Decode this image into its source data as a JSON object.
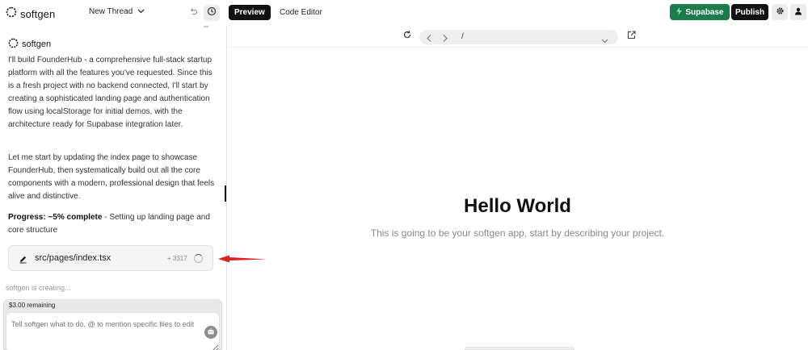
{
  "header": {
    "brand": "softgen",
    "thread_label": "New Thread",
    "tabs": [
      {
        "label": "Preview",
        "active": true
      },
      {
        "label": "Code Editor",
        "active": false
      }
    ],
    "supabase_label": "Supabase",
    "publish_label": "Publish",
    "colors": {
      "supabase": "#1c7a4d",
      "publish": "#111111"
    }
  },
  "chat": {
    "sender": "softgen",
    "paragraphs": [
      "I'll build FounderHub - a comprehensive full-stack startup platform with all the features you've requested. Since this is a fresh project with no backend connected, I'll start by creating a sophisticated landing page and authentication flow using localStorage for initial demos, with the architecture ready for Supabase integration later.",
      "Let me start by updating the index page to showcase FounderHub, then systematically build out all the core components with a modern, professional design that feels alive and distinctive."
    ],
    "progress_label": "Progress: ~5% complete",
    "progress_detail": " - Setting up landing page and core structure",
    "file_card": {
      "path": "src/pages/index.tsx",
      "count": "+ 3317"
    },
    "status": "softgen is creating...",
    "remaining": "$3.00 remaining",
    "input_placeholder": "Tell softgen what to do, @ to mention specific files to edit"
  },
  "preview": {
    "url": "/",
    "heading": "Hello World",
    "subtext": "This is going to be your softgen app, start by describing your project."
  },
  "annotation": {
    "color": "#e02020"
  }
}
